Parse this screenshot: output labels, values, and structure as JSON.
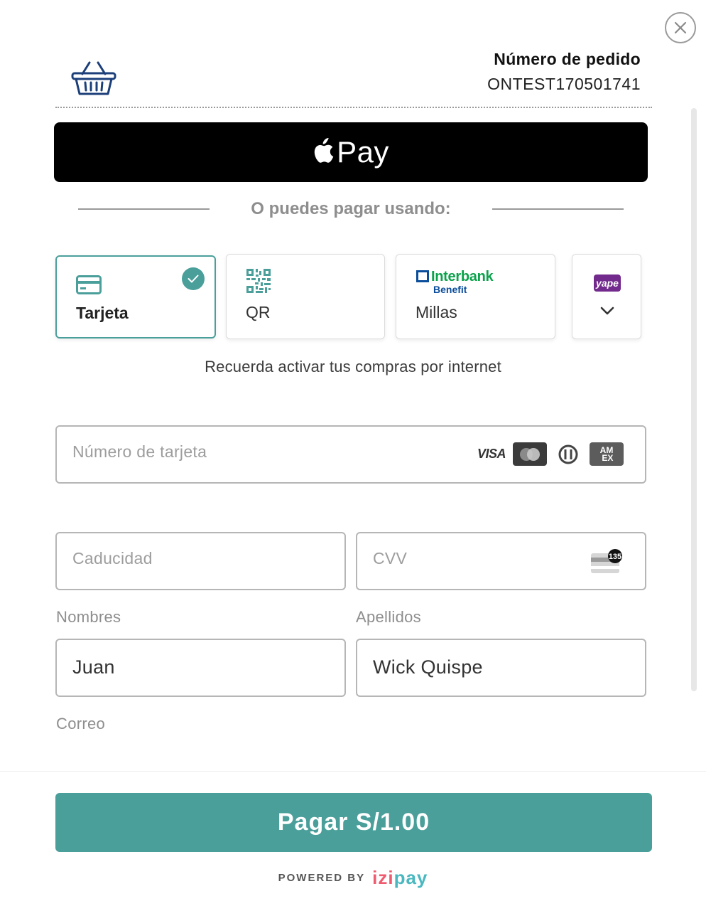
{
  "order": {
    "label": "Número de pedido",
    "number": "ONTEST170501741"
  },
  "apple_pay": {
    "label": "Pay"
  },
  "divider": {
    "text": "O puedes pagar usando:"
  },
  "methods": [
    {
      "label": "Tarjeta",
      "icon": "credit-card-icon",
      "selected": true
    },
    {
      "label": "QR",
      "icon": "qr-code-icon",
      "selected": false
    },
    {
      "label": "Millas",
      "logo_name": "Interbank",
      "logo_sub": "Benefit",
      "selected": false
    },
    {
      "logo_text": "yape",
      "icon": "chevron-down-icon",
      "selected": false
    }
  ],
  "reminder": "Recuerda activar tus compras por internet",
  "form": {
    "card_number_placeholder": "Número de tarjeta",
    "card_brands": [
      "VISA",
      "Mastercard",
      "Diners",
      "AMEX"
    ],
    "amex_text": "AM\nEX",
    "expiry_placeholder": "Caducidad",
    "cvv_placeholder": "CVV",
    "cvv_hint": "135",
    "first_name_label": "Nombres",
    "first_name_value": "Juan",
    "last_name_label": "Apellidos",
    "last_name_value": "Wick Quispe",
    "email_label": "Correo"
  },
  "pay_button": "Pagar S/1.00",
  "powered_by": {
    "prefix": "POWERED BY",
    "brand_1": "izi",
    "brand_2": "pay"
  },
  "colors": {
    "accent": "#4a9f9b",
    "apple_pay_bg": "#000000",
    "interbank_green": "#0aa24b",
    "interbank_blue": "#0a4d9a",
    "yape_purple": "#722a8c"
  }
}
